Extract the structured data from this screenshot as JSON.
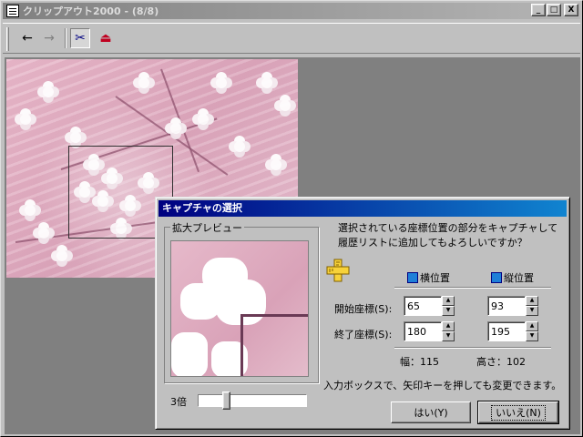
{
  "window": {
    "title": "クリップアウト2000 - (8/8)",
    "min_label": "_",
    "max_label": "□",
    "close_label": "X"
  },
  "toolbar": {
    "back_glyph": "←",
    "forward_glyph": "→",
    "capture_glyph": "✂",
    "exit_glyph": "⏏"
  },
  "icons": {
    "back": "back-arrow-icon",
    "forward": "forward-arrow-icon",
    "capture": "scissors-icon",
    "exit": "exit-door-icon",
    "ruler": "ruler-icon"
  },
  "dialog": {
    "title": "キャプチャの選択",
    "preview_label": "拡大プレビュー",
    "zoom_label": "3倍",
    "zoom_fraction": 0.25,
    "message_line1": "選択されている座標位置の部分をキャプチャして",
    "message_line2": "履歴リストに追加してもよろしいですか？",
    "col_horizontal": "横位置",
    "col_vertical": "縦位置",
    "start_label": "開始座標(S):",
    "end_label": "終了座標(S):",
    "start_x": "65",
    "start_y": "93",
    "end_x": "180",
    "end_y": "195",
    "width_text": "幅：115",
    "height_text": "高さ：102",
    "hint": "入力ボックスで、矢印キーを押しても変更できます。",
    "yes_button": "はい(Y)",
    "no_button": "いいえ(N)"
  },
  "colors": {
    "dialog_title_bg": "#000080",
    "inactive_title_bg": "#808080",
    "face": "#c0c0c0"
  }
}
